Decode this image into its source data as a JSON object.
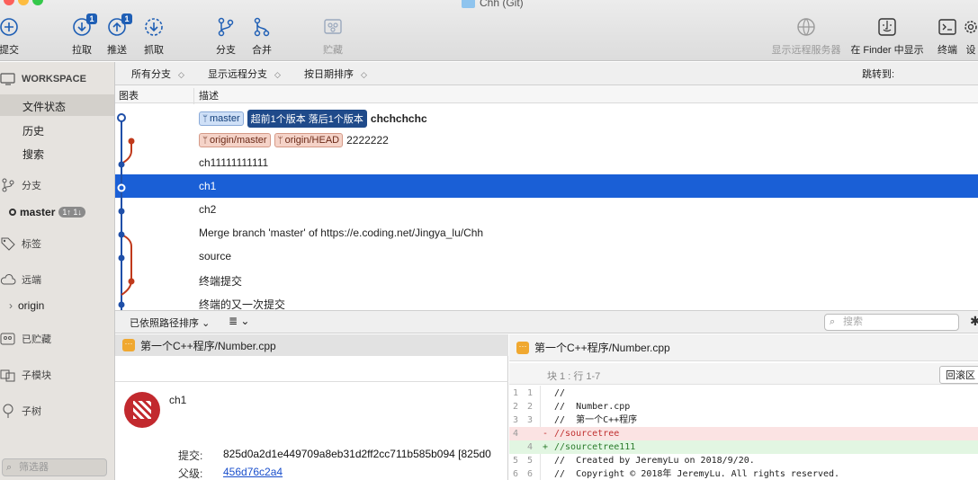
{
  "window": {
    "title": "Chh (Git)"
  },
  "toolbar": {
    "commit": "提交",
    "pull": "拉取",
    "pull_badge": "1",
    "push": "推送",
    "push_badge": "1",
    "fetch": "抓取",
    "branch": "分支",
    "merge": "合并",
    "stash": "贮藏",
    "show_remote": "显示远程服务器",
    "show_in_finder": "在 Finder 中显示",
    "terminal": "终端",
    "settings_partial": "设"
  },
  "sidebar": {
    "workspace": "WORKSPACE",
    "file_status": "文件状态",
    "history": "历史",
    "search": "搜索",
    "branches": "分支",
    "master_branch": "master",
    "master_badge": "1↑ 1↓",
    "tags": "标签",
    "remotes": "远端",
    "origin": "origin",
    "stashes": "已贮藏",
    "submodules": "子模块",
    "subtrees": "子树",
    "filter_placeholder": "筛选器"
  },
  "filterbar": {
    "all_branches": "所有分支",
    "show_remote_branches": "显示远程分支",
    "sort_by_date": "按日期排序",
    "jump_to": "跳转到:"
  },
  "columns": {
    "graph": "图表",
    "description": "描述"
  },
  "commits": [
    {
      "tags": [
        {
          "type": "local",
          "label": "master"
        },
        {
          "type": "status",
          "label": "超前1个版本 落后1个版本"
        }
      ],
      "message": "chchchchc",
      "bold": true
    },
    {
      "tags": [
        {
          "type": "remote",
          "label": "origin/master"
        },
        {
          "type": "remote",
          "label": "origin/HEAD"
        }
      ],
      "message": "2222222"
    },
    {
      "tags": [],
      "message": "ch11111111111"
    },
    {
      "tags": [],
      "message": "ch1",
      "selected": true
    },
    {
      "tags": [],
      "message": "ch2"
    },
    {
      "tags": [],
      "message": "Merge branch 'master' of https://e.coding.net/Jingya_lu/Chh"
    },
    {
      "tags": [],
      "message": "source"
    },
    {
      "tags": [],
      "message": "终端提交"
    },
    {
      "tags": [],
      "message": "终端的又一次提交"
    }
  ],
  "bottombar": {
    "sort_label": "已依照路径排序",
    "search_placeholder": "搜索"
  },
  "filelist": {
    "file": "第一个C++程序/Number.cpp",
    "author": "ch1",
    "commit_label": "提交:",
    "commit_hash": "825d0a2d1e449709a8eb31d2ff2cc711b585b094 [825d0",
    "parent_label": "父级:",
    "parent_hash": "456d76c2a4"
  },
  "diff": {
    "file": "第一个C++程序/Number.cpp",
    "hunk": "块 1 : 行 1-7",
    "revert": "回滚区",
    "lines": [
      {
        "n1": "1",
        "n2": "1",
        "mark": " ",
        "code": "//",
        "type": "ctx"
      },
      {
        "n1": "2",
        "n2": "2",
        "mark": " ",
        "code": "//  Number.cpp",
        "type": "ctx"
      },
      {
        "n1": "3",
        "n2": "3",
        "mark": " ",
        "code": "//  第一个C++程序",
        "type": "ctx"
      },
      {
        "n1": "4",
        "n2": "",
        "mark": "-",
        "code": "//sourcetree",
        "type": "del"
      },
      {
        "n1": "",
        "n2": "4",
        "mark": "+",
        "code": "//sourcetree111",
        "type": "add"
      },
      {
        "n1": "5",
        "n2": "5",
        "mark": " ",
        "code": "//  Created by JeremyLu on 2018/9/20.",
        "type": "ctx"
      },
      {
        "n1": "6",
        "n2": "6",
        "mark": " ",
        "code": "//  Copyright © 2018年 JeremyLu. All rights reserved.",
        "type": "ctx"
      }
    ]
  },
  "colors": {
    "selection": "#1a5fd6",
    "graph_blue": "#1f4fa8",
    "graph_red": "#c0391b"
  }
}
